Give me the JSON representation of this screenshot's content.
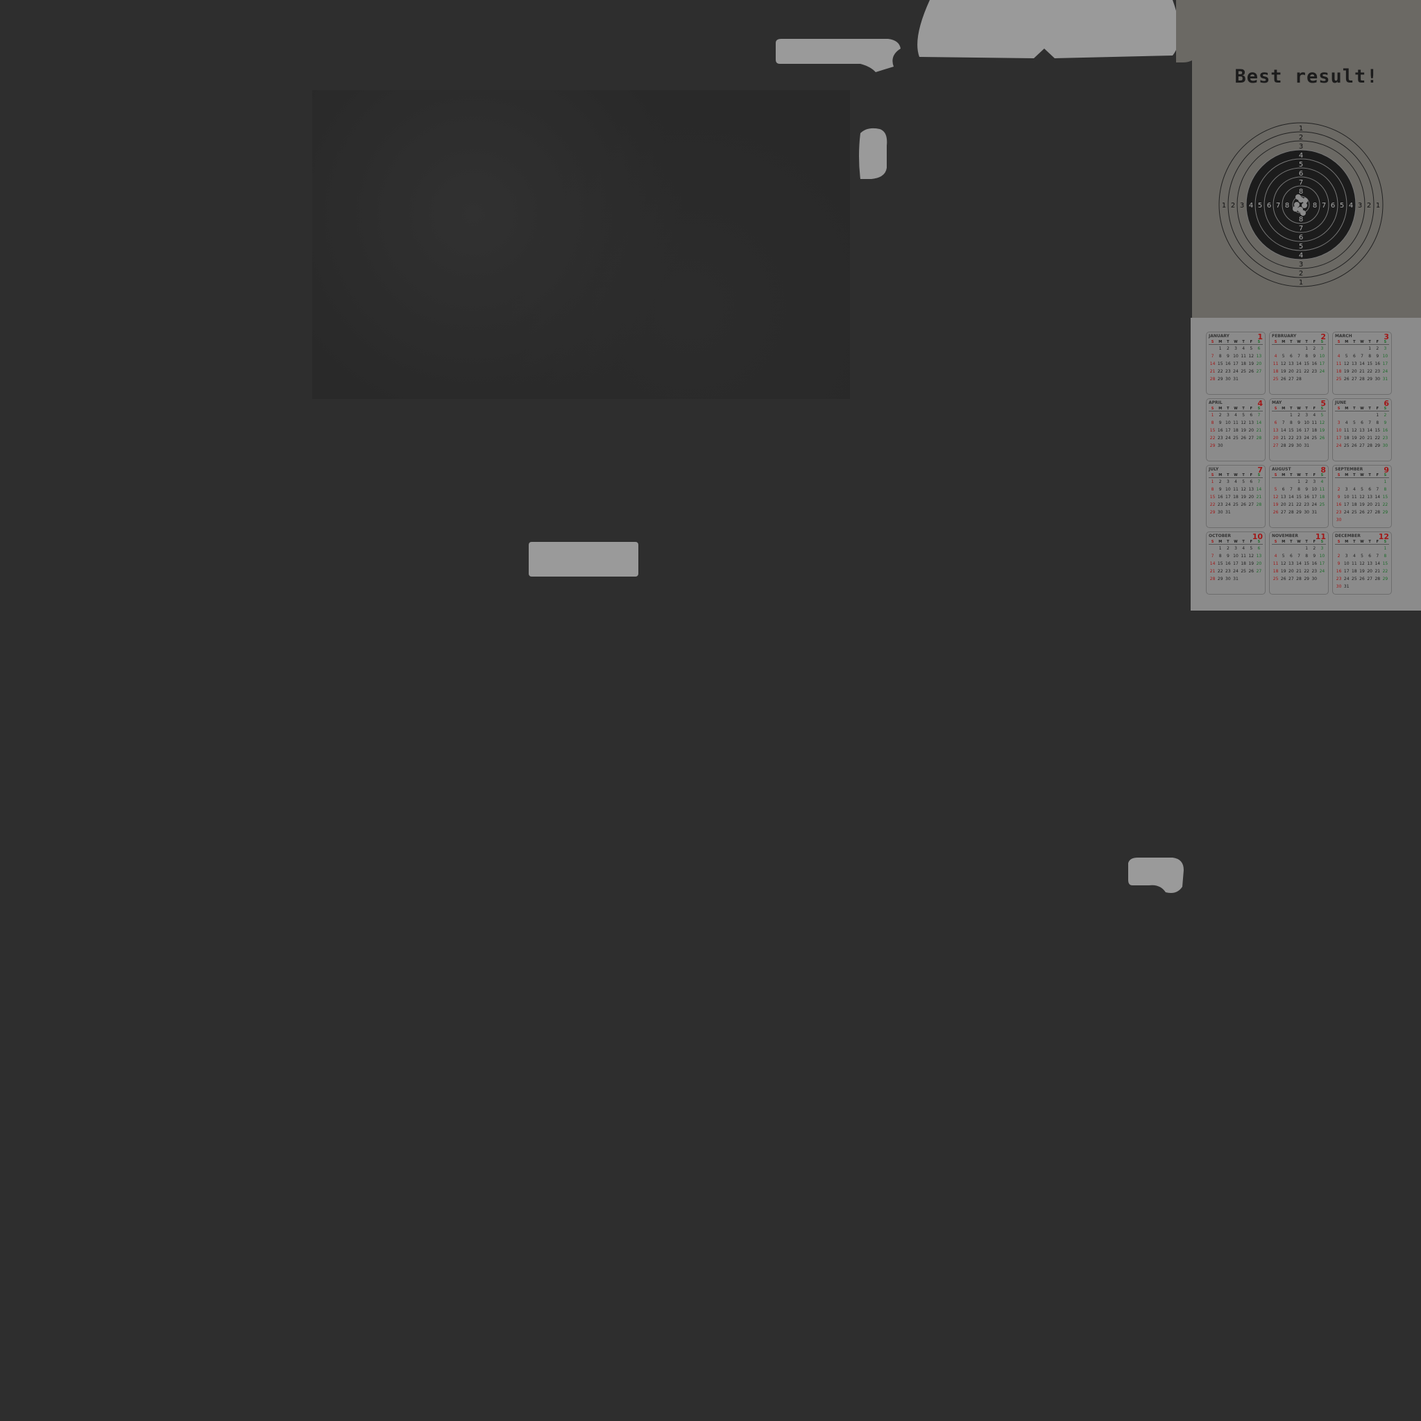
{
  "target_card": {
    "title": "Best result!",
    "ring_numbers": [
      "1",
      "2",
      "3",
      "4",
      "5",
      "6",
      "7",
      "8"
    ]
  },
  "calendar": {
    "weekdays": [
      "S",
      "M",
      "T",
      "W",
      "T",
      "F",
      "S"
    ],
    "months": [
      {
        "name": "JANUARY",
        "num": "1",
        "offset": 1,
        "days": 31
      },
      {
        "name": "FEBRUARY",
        "num": "2",
        "offset": 4,
        "days": 28
      },
      {
        "name": "MARCH",
        "num": "3",
        "offset": 4,
        "days": 31
      },
      {
        "name": "APRIL",
        "num": "4",
        "offset": 0,
        "days": 30
      },
      {
        "name": "MAY",
        "num": "5",
        "offset": 2,
        "days": 31
      },
      {
        "name": "JUNE",
        "num": "6",
        "offset": 5,
        "days": 30
      },
      {
        "name": "JULY",
        "num": "7",
        "offset": 0,
        "days": 31
      },
      {
        "name": "AUGUST",
        "num": "8",
        "offset": 3,
        "days": 31
      },
      {
        "name": "SEPTEMBER",
        "num": "9",
        "offset": 6,
        "days": 30
      },
      {
        "name": "OCTOBER",
        "num": "10",
        "offset": 1,
        "days": 31
      },
      {
        "name": "NOVEMBER",
        "num": "11",
        "offset": 4,
        "days": 30
      },
      {
        "name": "DECEMBER",
        "num": "12",
        "offset": 6,
        "days": 31
      }
    ]
  },
  "colors": {
    "background": "#2e2e2e",
    "target_card": "#6b6964",
    "calendar_card": "#8b8b8b",
    "light_pieces": "#9a9a9a",
    "sunday": "#a11818",
    "saturday": "#1f6d2c"
  }
}
